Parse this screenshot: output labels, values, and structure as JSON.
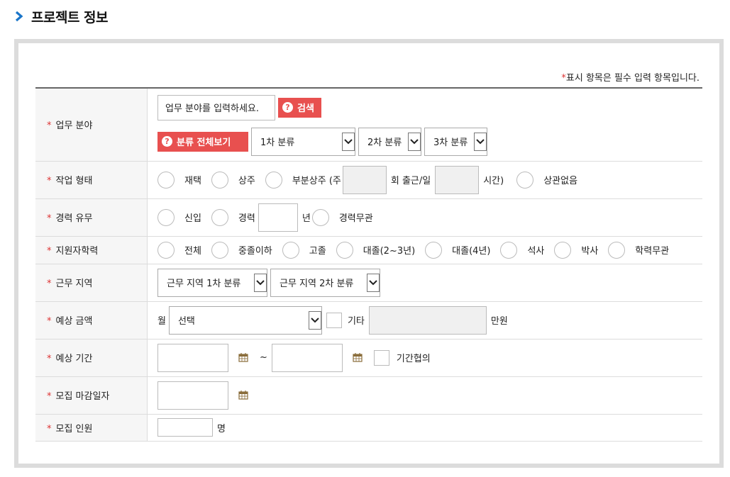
{
  "page": {
    "title": "프로젝트 정보"
  },
  "required_note": {
    "star": "*",
    "text": "표시 항목은 필수 입력 항목입니다."
  },
  "colors": {
    "accent_red": "#e8504f",
    "required_star": "#dd3333",
    "chevron_blue": "#1a75c9"
  },
  "rows": {
    "field": {
      "label": "업무 분야",
      "input_value": "업무 분야를 입력하세요.",
      "search_button": "검색",
      "view_all_button": "분류 전체보기",
      "select1": "1차 분류",
      "select2": "2차 분류",
      "select3": "3차 분류"
    },
    "work_type": {
      "label": "작업 형태",
      "opt_remote": "재택",
      "opt_resident": "상주",
      "opt_partial": "부분상주 (주",
      "unit_times": "회 출근/일",
      "unit_hours": "시간)",
      "opt_any": "상관없음"
    },
    "career": {
      "label": "경력 유무",
      "opt_new": "신입",
      "opt_exp": "경력",
      "unit_year": "년",
      "opt_any": "경력무관"
    },
    "education": {
      "label": "지원자학력",
      "options": [
        "전체",
        "중졸이하",
        "고졸",
        "대졸(2~3년)",
        "대졸(4년)",
        "석사",
        "박사",
        "학력무관"
      ]
    },
    "location": {
      "label": "근무 지역",
      "select1": "근무 지역 1차 분류",
      "select2": "근무 지역 2차 분류"
    },
    "budget": {
      "label": "예상 금액",
      "prefix": "월",
      "select": "선택",
      "other_label": "기타",
      "unit": "만원"
    },
    "period": {
      "label": "예상 기간",
      "tilde": "~",
      "negotiable_label": "기간협의"
    },
    "deadline": {
      "label": "모집 마감일자"
    },
    "headcount": {
      "label": "모집 인원",
      "unit": "명"
    }
  }
}
